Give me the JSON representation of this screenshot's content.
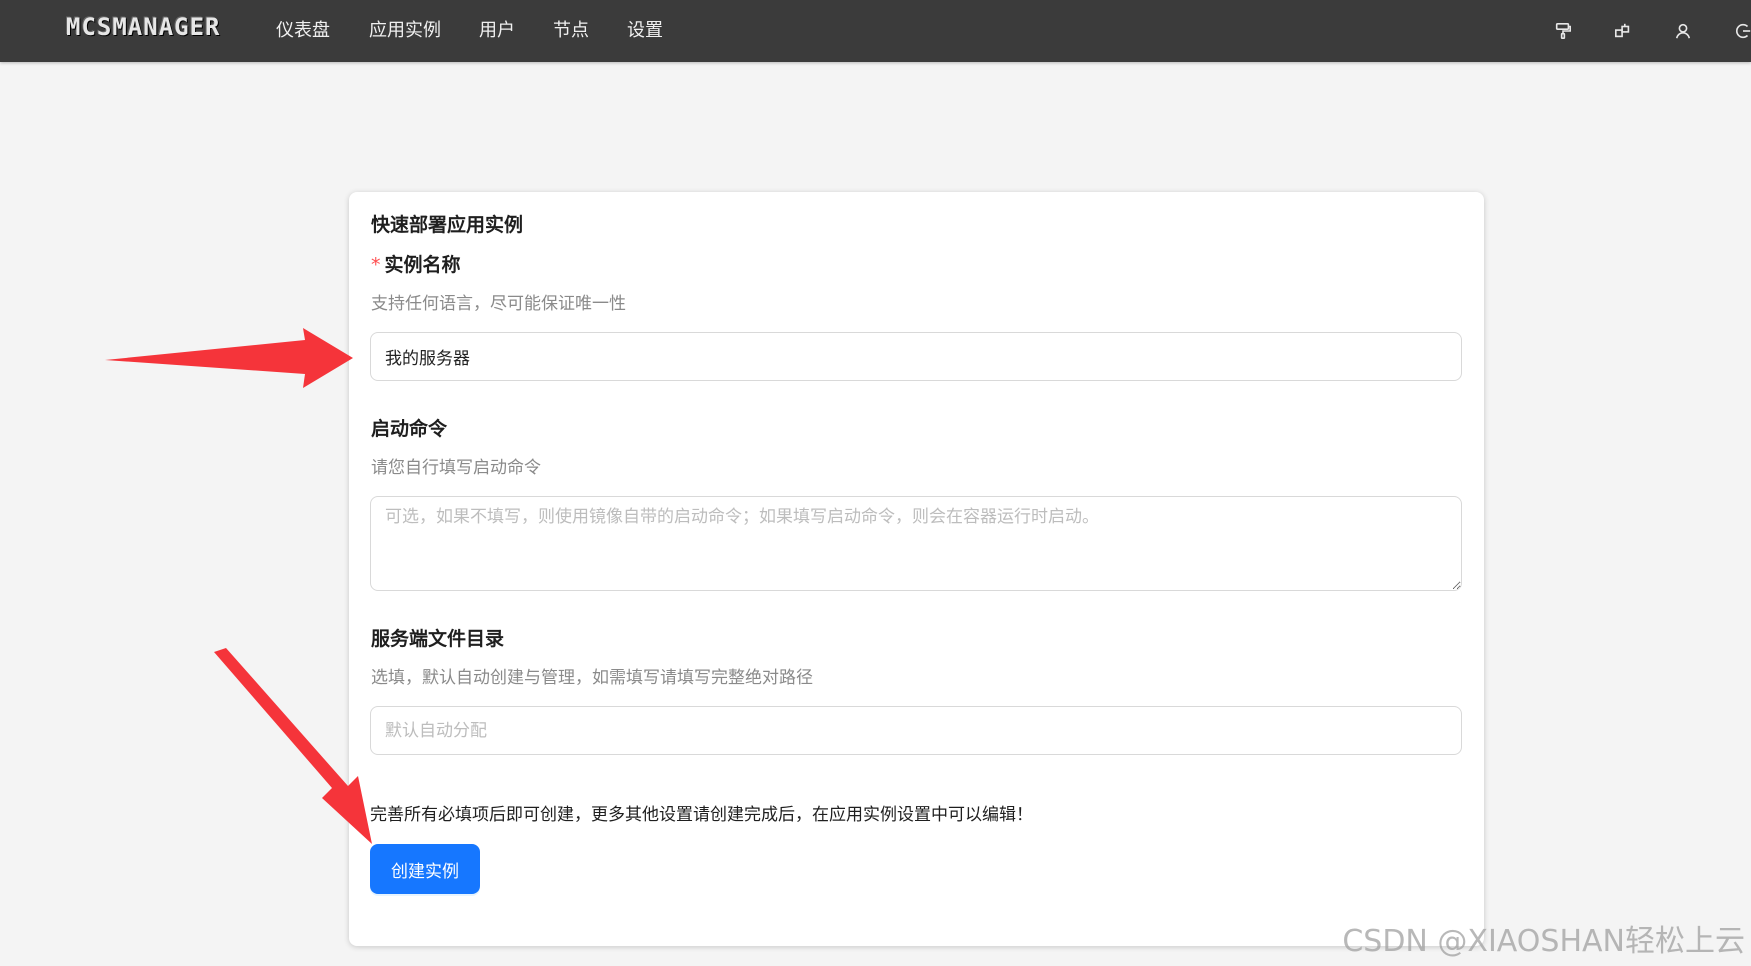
{
  "brand": {
    "logo_text": "MCSMANAGER"
  },
  "nav": {
    "items": [
      {
        "label": "仪表盘"
      },
      {
        "label": "应用实例"
      },
      {
        "label": "用户"
      },
      {
        "label": "节点"
      },
      {
        "label": "设置"
      }
    ]
  },
  "header_icons": [
    "paint-roller-icon",
    "layout-blocks-icon",
    "user-icon",
    "logout-icon"
  ],
  "form": {
    "title": "快速部署应用实例",
    "instance_name": {
      "required_mark": "*",
      "label": "实例名称",
      "description": "支持任何语言，尽可能保证唯一性",
      "value": "我的服务器"
    },
    "start_command": {
      "label": "启动命令",
      "description": "请您自行填写启动命令",
      "placeholder": "可选，如果不填写，则使用镜像自带的启动命令；如果填写启动命令，则会在容器运行时启动。"
    },
    "server_dir": {
      "label": "服务端文件目录",
      "description": "选填，默认自动创建与管理，如需填写请填写完整绝对路径",
      "placeholder": "默认自动分配"
    },
    "hint": "完善所有必填项后即可创建，更多其他设置请创建完成后，在应用实例设置中可以编辑！",
    "submit_label": "创建实例"
  },
  "annotation_color": "#f5343a",
  "accent_color": "#1677ff",
  "watermark": "CSDN @XIAOSHAN轻松上云"
}
